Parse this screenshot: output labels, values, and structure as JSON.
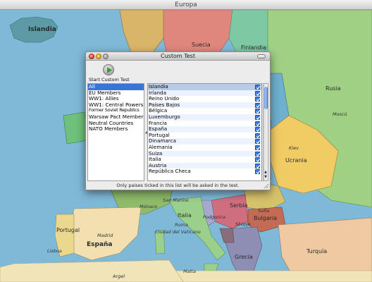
{
  "window": {
    "title": "Europa"
  },
  "dialog": {
    "title": "Custom Test",
    "start_label": "Start Custom Test",
    "footer_note": "Only paises ticked in this list will be asked in the test."
  },
  "groups": [
    {
      "label": "All",
      "selected": true
    },
    {
      "label": "EU Members",
      "selected": false
    },
    {
      "label": "WW1: Allies",
      "selected": false
    },
    {
      "label": "WW1: Central Powers",
      "selected": false
    },
    {
      "label": "Former Soviet Republics",
      "selected": false
    },
    {
      "label": "Warsaw Pact Members",
      "selected": false
    },
    {
      "label": "Neutral Countries",
      "selected": false
    },
    {
      "label": "NATO Members",
      "selected": false
    }
  ],
  "countries": [
    {
      "name": "Islandia",
      "checked": true,
      "selected": true
    },
    {
      "name": "Irlanda",
      "checked": true
    },
    {
      "name": "Reino Unido",
      "checked": true
    },
    {
      "name": "Países Bajos",
      "checked": true
    },
    {
      "name": "Bélgica",
      "checked": true
    },
    {
      "name": "Luxemburgo",
      "checked": true
    },
    {
      "name": "Francia",
      "checked": true
    },
    {
      "name": "España",
      "checked": true
    },
    {
      "name": "Portugal",
      "checked": true
    },
    {
      "name": "Dinamarca",
      "checked": true
    },
    {
      "name": "Alemania",
      "checked": true
    },
    {
      "name": "Suiza",
      "checked": true
    },
    {
      "name": "Italia",
      "checked": true
    },
    {
      "name": "Austria",
      "checked": true
    },
    {
      "name": "República Checa",
      "checked": true
    }
  ],
  "map": {
    "country_labels": [
      "Islandia",
      "Suecia",
      "Finlandia",
      "Rusia",
      "Ucrania",
      "Portugal",
      "España",
      "Italia",
      "Mónaco",
      "San Marino",
      "Ciudad del Vaticano",
      "Serbia",
      "Bulgaria",
      "Turquía",
      "Malta",
      "Grecia",
      "Podgorica",
      "Skopje",
      "Sofía",
      "Roma",
      "Madrid",
      "Lisboa",
      "Moscú",
      "Kiev",
      "Argel"
    ],
    "colors": {
      "sea": "#7fb9d8",
      "islandia": "#5c9aa6",
      "suecia": "#e0877d",
      "finlandia": "#7ec9a4",
      "rusia": "#9fd084",
      "ucrania": "#f1cb64",
      "espana": "#f2e0b0",
      "portugal": "#ead88e",
      "italia": "#9ad08c",
      "turquia": "#eec9a1",
      "bulgaria": "#c36b54",
      "africa": "#f1e4b8"
    }
  }
}
